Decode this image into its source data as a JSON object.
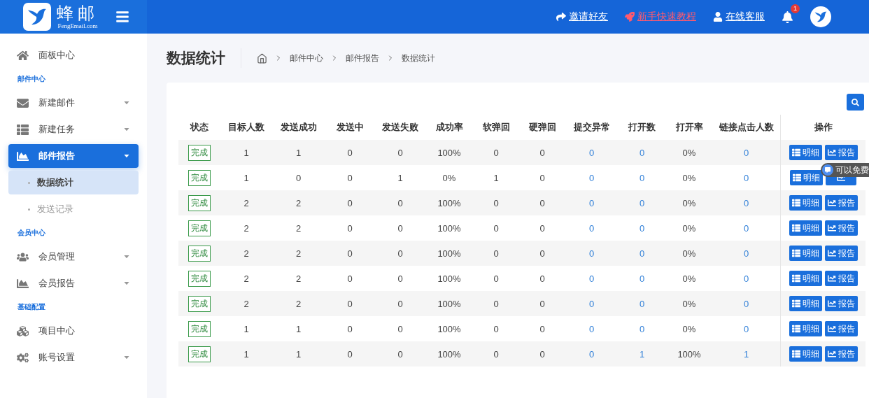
{
  "header": {
    "logo_title": "蜂邮",
    "logo_subtitle": "FengEmail.com",
    "links": [
      {
        "label": "邀请好友",
        "highlight": false
      },
      {
        "label": "新手快速教程",
        "highlight": true
      },
      {
        "label": "在线客服",
        "highlight": false
      }
    ],
    "notification_count": "1"
  },
  "sidebar": {
    "items": [
      {
        "kind": "item",
        "label": "面板中心",
        "expandable": false,
        "selected": false
      },
      {
        "kind": "section",
        "label": "邮件中心"
      },
      {
        "kind": "item",
        "label": "新建邮件",
        "expandable": true,
        "selected": false
      },
      {
        "kind": "item",
        "label": "新建任务",
        "expandable": true,
        "selected": false
      },
      {
        "kind": "item",
        "label": "邮件报告",
        "expandable": true,
        "selected": true,
        "expanded": true,
        "children": [
          {
            "label": "数据统计",
            "selected": true
          },
          {
            "label": "发送记录",
            "selected": false
          }
        ]
      },
      {
        "kind": "section",
        "label": "会员中心"
      },
      {
        "kind": "item",
        "label": "会员管理",
        "expandable": true,
        "selected": false
      },
      {
        "kind": "item",
        "label": "会员报告",
        "expandable": true,
        "selected": false
      },
      {
        "kind": "section",
        "label": "基础配置"
      },
      {
        "kind": "item",
        "label": "项目中心",
        "expandable": false,
        "selected": false
      },
      {
        "kind": "item",
        "label": "账号设置",
        "expandable": true,
        "selected": false
      }
    ]
  },
  "page": {
    "title": "数据统计",
    "breadcrumb": [
      "邮件中心",
      "邮件报告",
      "数据统计"
    ]
  },
  "table": {
    "columns": [
      {
        "label": "状态"
      },
      {
        "label": "目标人数"
      },
      {
        "label": "发送成功"
      },
      {
        "label": "发送中"
      },
      {
        "label": "发送失败"
      },
      {
        "label": "成功率"
      },
      {
        "label": "软弹回"
      },
      {
        "label": "硬弹回"
      },
      {
        "label": "提交异常",
        "link": true
      },
      {
        "label": "打开数",
        "link": true
      },
      {
        "label": "打开率"
      },
      {
        "label": "链接点击人数",
        "link": true
      },
      {
        "label": "操作"
      }
    ],
    "rows": [
      {
        "status": "完成",
        "values": [
          "1",
          "1",
          "0",
          "0",
          "100%",
          "0",
          "0",
          "0",
          "0",
          "0%",
          "0"
        ],
        "actions": [
          {
            "kind": "detail",
            "label": "明细"
          },
          {
            "kind": "report",
            "label": "报告"
          }
        ]
      },
      {
        "status": "完成",
        "values": [
          "1",
          "0",
          "0",
          "1",
          "0%",
          "1",
          "0",
          "0",
          "0",
          "0%",
          "0"
        ],
        "actions": [
          {
            "kind": "detail",
            "label": "明细"
          },
          {
            "kind": "report"
          }
        ]
      },
      {
        "status": "完成",
        "values": [
          "2",
          "2",
          "0",
          "0",
          "100%",
          "0",
          "0",
          "0",
          "0",
          "0%",
          "0"
        ],
        "actions": [
          {
            "kind": "detail",
            "label": "明细"
          },
          {
            "kind": "report",
            "label": "报告"
          }
        ]
      },
      {
        "status": "完成",
        "values": [
          "2",
          "2",
          "0",
          "0",
          "100%",
          "0",
          "0",
          "0",
          "0",
          "0%",
          "0"
        ],
        "actions": [
          {
            "kind": "detail",
            "label": "明细"
          },
          {
            "kind": "report",
            "label": "报告"
          }
        ]
      },
      {
        "status": "完成",
        "values": [
          "2",
          "2",
          "0",
          "0",
          "100%",
          "0",
          "0",
          "0",
          "0",
          "0%",
          "0"
        ],
        "actions": [
          {
            "kind": "detail",
            "label": "明细"
          },
          {
            "kind": "report",
            "label": "报告"
          }
        ]
      },
      {
        "status": "完成",
        "values": [
          "2",
          "2",
          "0",
          "0",
          "100%",
          "0",
          "0",
          "0",
          "0",
          "0%",
          "0"
        ],
        "actions": [
          {
            "kind": "detail",
            "label": "明细"
          },
          {
            "kind": "report",
            "label": "报告"
          }
        ]
      },
      {
        "status": "完成",
        "values": [
          "2",
          "2",
          "0",
          "0",
          "100%",
          "0",
          "0",
          "0",
          "0",
          "0%",
          "0"
        ],
        "actions": [
          {
            "kind": "detail",
            "label": "明细"
          },
          {
            "kind": "report",
            "label": "报告"
          }
        ]
      },
      {
        "status": "完成",
        "values": [
          "1",
          "1",
          "0",
          "0",
          "100%",
          "0",
          "0",
          "0",
          "0",
          "0%",
          "0"
        ],
        "actions": [
          {
            "kind": "detail",
            "label": "明细"
          },
          {
            "kind": "report",
            "label": "报告"
          }
        ]
      },
      {
        "status": "完成",
        "values": [
          "1",
          "1",
          "0",
          "0",
          "100%",
          "0",
          "0",
          "0",
          "1",
          "100%",
          "1"
        ],
        "actions": [
          {
            "kind": "detail",
            "label": "明细"
          },
          {
            "kind": "report",
            "label": "报告"
          }
        ]
      }
    ]
  },
  "chat_chip": {
    "label": "可以免费"
  }
}
